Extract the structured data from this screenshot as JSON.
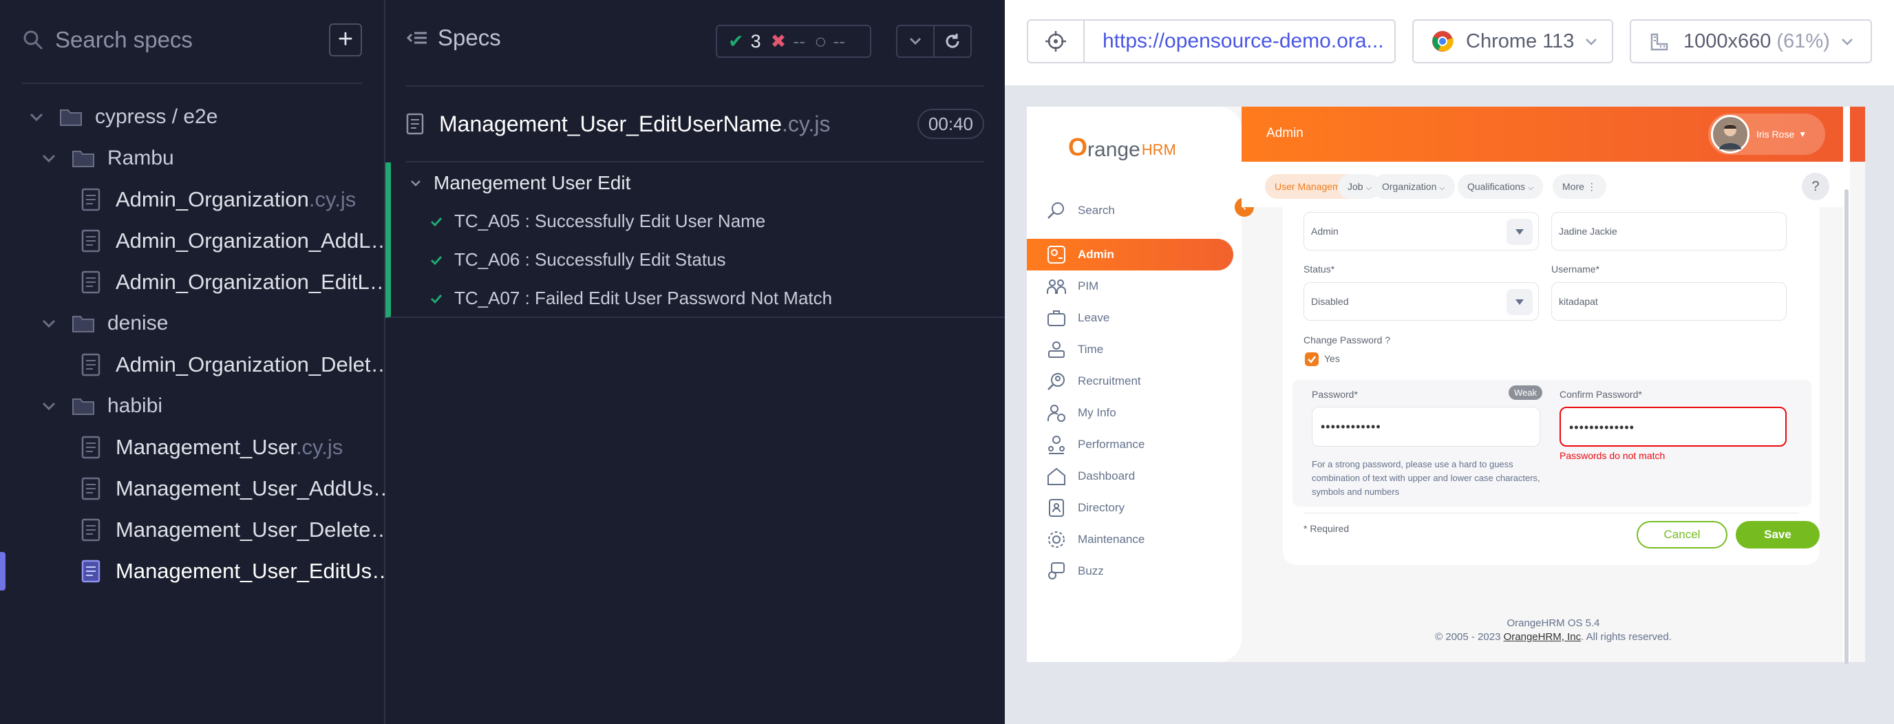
{
  "sidebar": {
    "search_placeholder": "Search specs",
    "tree": [
      {
        "kind": "folder",
        "label": "cypress / e2e"
      },
      {
        "kind": "folder",
        "label": "Rambu"
      },
      {
        "kind": "file",
        "name": "Admin_Organization",
        "ext": ".cy.js"
      },
      {
        "kind": "file",
        "name": "Admin_Organization_AddL…",
        "ext": ""
      },
      {
        "kind": "file",
        "name": "Admin_Organization_EditL…",
        "ext": ""
      },
      {
        "kind": "folder",
        "label": "denise"
      },
      {
        "kind": "file",
        "name": "Admin_Organization_Delet…",
        "ext": ""
      },
      {
        "kind": "folder",
        "label": "habibi"
      },
      {
        "kind": "file",
        "name": "Management_User",
        "ext": ".cy.js"
      },
      {
        "kind": "file",
        "name": "Management_User_AddUs…",
        "ext": ""
      },
      {
        "kind": "file",
        "name": "Management_User_Delete…",
        "ext": ""
      },
      {
        "kind": "file",
        "name": "Management_User_EditUs…",
        "ext": ""
      }
    ]
  },
  "reporter": {
    "title": "Specs",
    "passed": "3",
    "failed": "--",
    "pending": "--",
    "spec_name": "Management_User_EditUserName",
    "spec_ext": ".cy.js",
    "duration": "00:40",
    "suite_title": "Manegement User Edit",
    "tests": [
      "TC_A05 : Successfully Edit User Name",
      "TC_A06 : Successfully Edit Status",
      "TC_A07 : Failed Edit User Password Not Match"
    ]
  },
  "toolbar": {
    "url": "https://opensource-demo.ora...",
    "browser": "Chrome 113",
    "viewport": "1000x660",
    "scale": "(61%)"
  },
  "app": {
    "logo_o": "O",
    "logo_range": "range",
    "logo_hrm": "HRM",
    "module": "Admin",
    "user_name": "Iris Rose",
    "nav": {
      "search": "Search",
      "items": [
        "Admin",
        "PIM",
        "Leave",
        "Time",
        "Recruitment",
        "My Info",
        "Performance",
        "Dashboard",
        "Directory",
        "Maintenance",
        "Buzz"
      ]
    },
    "tabs": [
      "User Management",
      "Job",
      "Organization",
      "Qualifications",
      "More"
    ],
    "help": "?",
    "form": {
      "user_role_value": "Admin",
      "employee_value": "Jadine  Jackie",
      "status_label": "Status*",
      "status_value": "Disabled",
      "username_label": "Username*",
      "username_value": "kitadapat",
      "change_password_label": "Change Password ?",
      "yes_label": "Yes",
      "password_label": "Password*",
      "password_strength": "Weak",
      "password_value": "••••••••••••",
      "confirm_label": "Confirm Password*",
      "confirm_value": "•••••••••••••",
      "error": "Passwords do not match",
      "hint": "For a strong password, please use a hard to guess combination of text with upper and lower case characters, symbols and numbers",
      "required": "* Required",
      "cancel": "Cancel",
      "save": "Save"
    },
    "footer_version": "OrangeHRM OS 5.4",
    "footer_copy_prefix": "© 2005 - 2023 ",
    "footer_company": "OrangeHRM, Inc",
    "footer_copy_suffix": ". All rights reserved."
  },
  "colors": {
    "pass": "#1fa971",
    "fail": "#e45770",
    "accent": "#f07c1c",
    "save": "#76bc21",
    "url": "#4956e3"
  }
}
